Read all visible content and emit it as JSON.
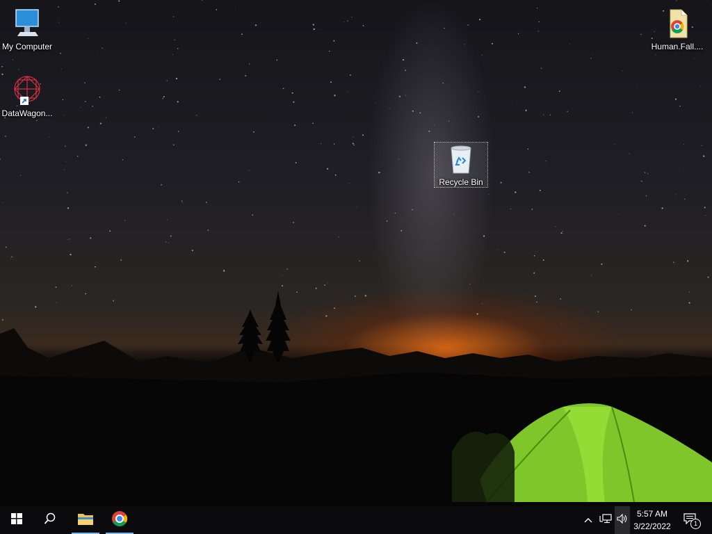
{
  "desktop": {
    "icons": [
      {
        "label": "My Computer",
        "icon": "computer-icon"
      },
      {
        "label": "DataWagon...",
        "icon": "datawagon-shortcut-icon"
      },
      {
        "label": "Human.Fall....",
        "icon": "chrome-file-icon"
      },
      {
        "label": "Recycle Bin",
        "icon": "recycle-bin-icon"
      }
    ]
  },
  "taskbar": {
    "start": "windows-start-icon",
    "search": "search-icon",
    "pinned": [
      {
        "name": "File Explorer",
        "icon": "folder-icon"
      },
      {
        "name": "Google Chrome",
        "icon": "chrome-icon"
      }
    ],
    "tray": {
      "time": "5:57 AM",
      "date": "3/22/2022",
      "notification_count": "1"
    }
  },
  "colors": {
    "taskbar_bg": "#0b0b0d",
    "accent": "#76b9ed"
  }
}
